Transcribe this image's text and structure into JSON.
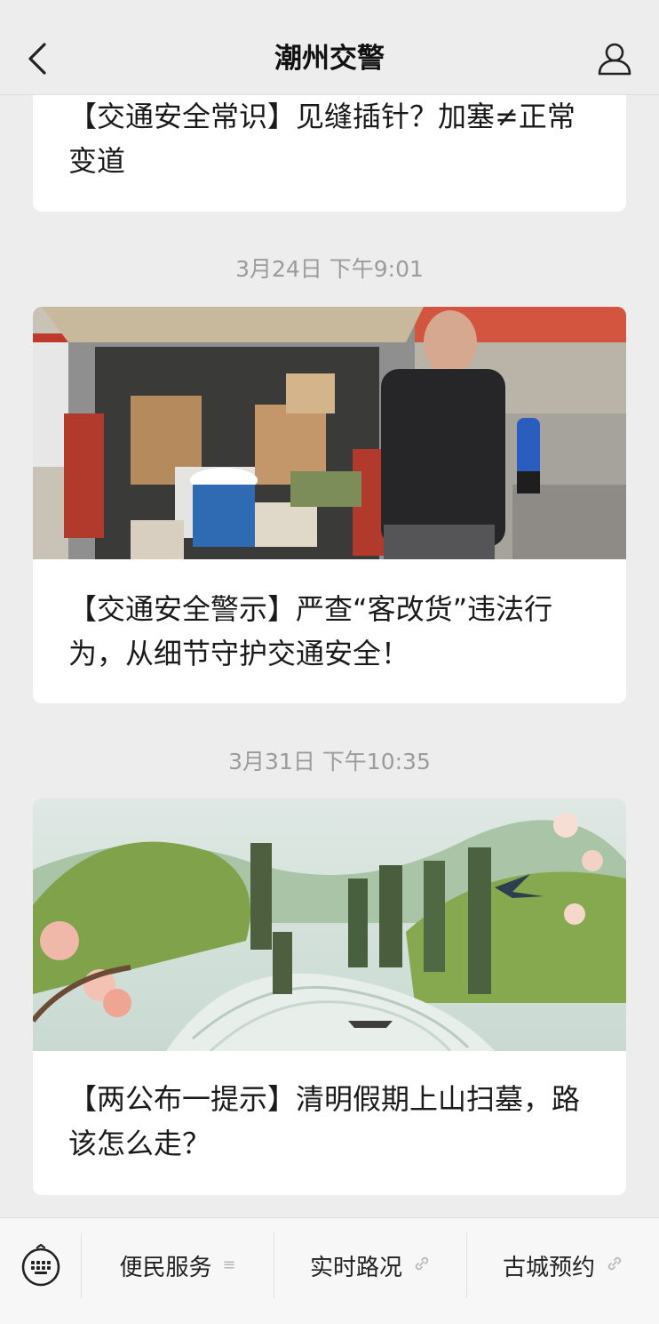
{
  "header": {
    "title": "潮州交警",
    "back_icon": "chevron-left-icon",
    "profile_icon": "person-icon"
  },
  "articles": [
    {
      "caption": "【交通安全常识】见缝插针？加塞≠正常变道"
    },
    {
      "timestamp": "3月24日 下午9:01",
      "caption": "【交通安全警示】严查“客改货”违法行为，从细节守护交通安全！"
    },
    {
      "timestamp": "3月31日 下午10:35",
      "caption": "【两公布一提示】清明假期上山扫墓，路该怎么走？"
    }
  ],
  "menu": {
    "keyboard_icon": "keyboard-icon",
    "items": [
      {
        "label": "便民服务",
        "icon": "menu-lines-icon"
      },
      {
        "label": "实时路况",
        "icon": "link-icon"
      },
      {
        "label": "古城预约",
        "icon": "link-icon"
      }
    ]
  },
  "colors": {
    "background": "#ededed",
    "card": "#ffffff",
    "timestamp": "#9b9b9b"
  }
}
